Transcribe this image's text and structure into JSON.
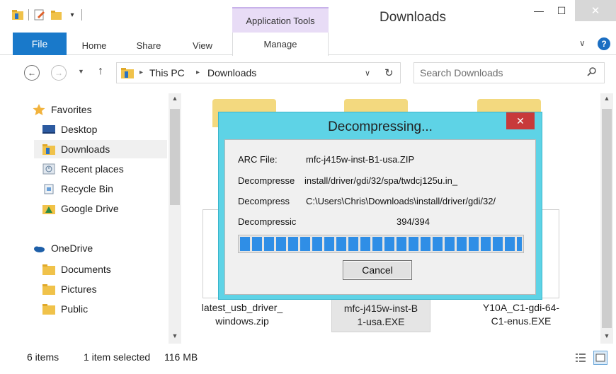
{
  "window": {
    "title": "Downloads",
    "context_tab_group": "Application Tools",
    "minimize_glyph": "—",
    "maximize_glyph": "☐",
    "close_glyph": "✕"
  },
  "quick_access": {
    "dropdown_glyph": "▾"
  },
  "ribbon": {
    "tabs": [
      "File",
      "Home",
      "Share",
      "View",
      "Manage"
    ],
    "expand_glyph": "∨",
    "help_glyph": "?"
  },
  "address": {
    "back_glyph": "←",
    "forward_glyph": "→",
    "recent_glyph": "▼",
    "up_glyph": "↑",
    "crumbs": [
      "This PC",
      "Downloads"
    ],
    "crumb_sep": "▸",
    "dropdown_glyph": "∨",
    "refresh_glyph": "↻"
  },
  "search": {
    "placeholder": "Search Downloads"
  },
  "navpane": {
    "favorites_label": "Favorites",
    "favorites": [
      "Desktop",
      "Downloads",
      "Recent places",
      "Recycle Bin",
      "Google Drive"
    ],
    "selected": "Downloads",
    "onedrive_label": "OneDrive",
    "onedrive": [
      "Documents",
      "Pictures",
      "Public"
    ],
    "scroll_up": "▲",
    "scroll_down": "▼"
  },
  "files": [
    {
      "name_line1": "latest_usb_driver_",
      "name_line2": "windows.zip"
    },
    {
      "name_line1": "mfc-j415w-inst-B",
      "name_line2": "1-usa.EXE"
    },
    {
      "name_line1": "Y10A_C1-gdi-64-",
      "name_line2": "C1-enus.EXE"
    }
  ],
  "dialog": {
    "title": "Decompressing...",
    "close_glyph": "✕",
    "arc_label": "ARC File:",
    "arc_value": "mfc-j415w-inst-B1-usa.ZIP",
    "row2_label": "Decompresse",
    "row2_value": "install/driver/gdi/32/spa/twdcj125u.in_",
    "row3_label": "Decompress",
    "row3_value": "C:\\Users\\Chris\\Downloads\\install/driver/gdi/32/",
    "row4_label": "Decompressic",
    "row4_value": "394/394",
    "progress_fraction": 1.0,
    "cancel_label": "Cancel"
  },
  "status": {
    "item_count": "6 items",
    "selection": "1 item selected",
    "size": "116 MB"
  },
  "colors": {
    "file_tab": "#1979ca",
    "context_tab": "#e8dcf6",
    "dialog_frame": "#5ed3e6",
    "dialog_close": "#c83a3a",
    "progress": "#2f8ee6",
    "folder": "#f3d97f"
  }
}
